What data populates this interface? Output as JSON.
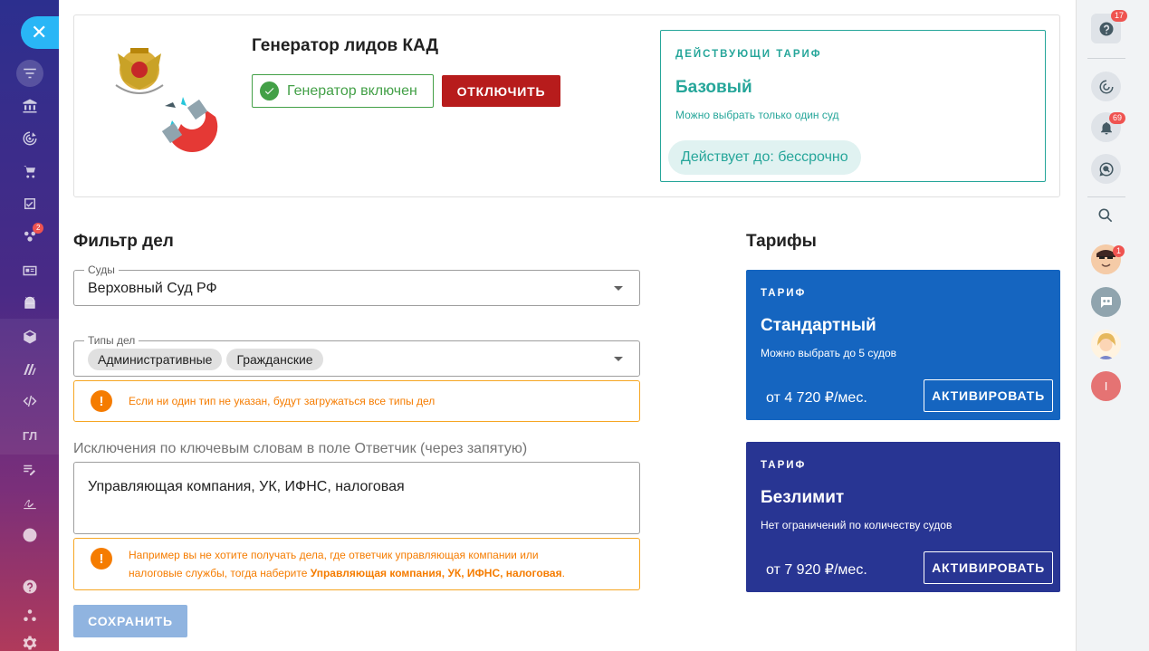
{
  "left_sidebar": {
    "close_icon": "close-icon",
    "items": [
      {
        "icon": "filter-icon"
      },
      {
        "icon": "bank-icon"
      },
      {
        "icon": "target-icon"
      },
      {
        "icon": "cart-icon"
      },
      {
        "icon": "checkbox-icon"
      },
      {
        "icon": "groups-icon",
        "badge": "2"
      },
      {
        "icon": "contact-card-icon"
      },
      {
        "icon": "android-icon"
      },
      {
        "icon": "box-icon"
      },
      {
        "icon": "m-logo-icon"
      },
      {
        "icon": "code-icon"
      },
      {
        "icon": "text-icon",
        "label": "ГЛ"
      },
      {
        "icon": "edit-list-icon"
      },
      {
        "icon": "signature-icon"
      },
      {
        "icon": "chevron-down-icon"
      },
      {
        "icon": "help-icon"
      },
      {
        "icon": "tree-icon"
      },
      {
        "icon": "gear-icon"
      }
    ]
  },
  "generator": {
    "title": "Генератор лидов КАД",
    "status": "Генератор включен",
    "disable_label": "ОТКЛЮЧИТЬ"
  },
  "current_plan": {
    "label": "ДЕЙСТВУЮЩИ ТАРИФ",
    "name": "Базовый",
    "description": "Можно выбрать только один суд",
    "until": "Действует до: бессрочно"
  },
  "filter": {
    "title": "Фильтр дел",
    "courts_label": "Суды",
    "courts_value": "Верховный Суд РФ",
    "types_label": "Типы дел",
    "types": [
      "Административные",
      "Гражданские"
    ],
    "types_hint": "Если ни один тип не указан, будут загружаться все типы дел",
    "exclusions_label": "Исключения по ключевым словам в поле Ответчик (через запятую)",
    "exclusions_value": "Управляющая компания, УК, ИФНС, налоговая",
    "exclusions_hint_line1": "Например вы не хотите получать дела, где ответчик управляющая компании или",
    "exclusions_hint_line2_prefix": "налоговые службы, тогда наберите ",
    "exclusions_hint_line2_bold": "Управляющая компания, УК, ИФНС, налоговая",
    "exclusions_hint_line2_suffix": ".",
    "save_label": "СОХРАНИТЬ"
  },
  "plans": {
    "title": "Тарифы",
    "items": [
      {
        "label": "ТАРИФ",
        "name": "Стандартный",
        "description": "Можно выбрать до 5 судов",
        "price": "от 4 720 ₽/мес.",
        "button": "АКТИВИРОВАТЬ",
        "color": "#1565c0"
      },
      {
        "label": "ТАРИФ",
        "name": "Безлимит",
        "description": "Нет ограничений по количеству судов",
        "price": "от 7 920 ₽/мес.",
        "button": "АКТИВИРОВАТЬ",
        "color": "#283593"
      }
    ]
  },
  "right_sidebar": {
    "help_badge": "17",
    "notifications_badge": "69",
    "avatar_badge": "1",
    "user_initial": "I"
  },
  "colors": {
    "accent_teal": "#26a69a",
    "success": "#43a047",
    "danger": "#b71c1c",
    "warning": "#f57c00"
  }
}
